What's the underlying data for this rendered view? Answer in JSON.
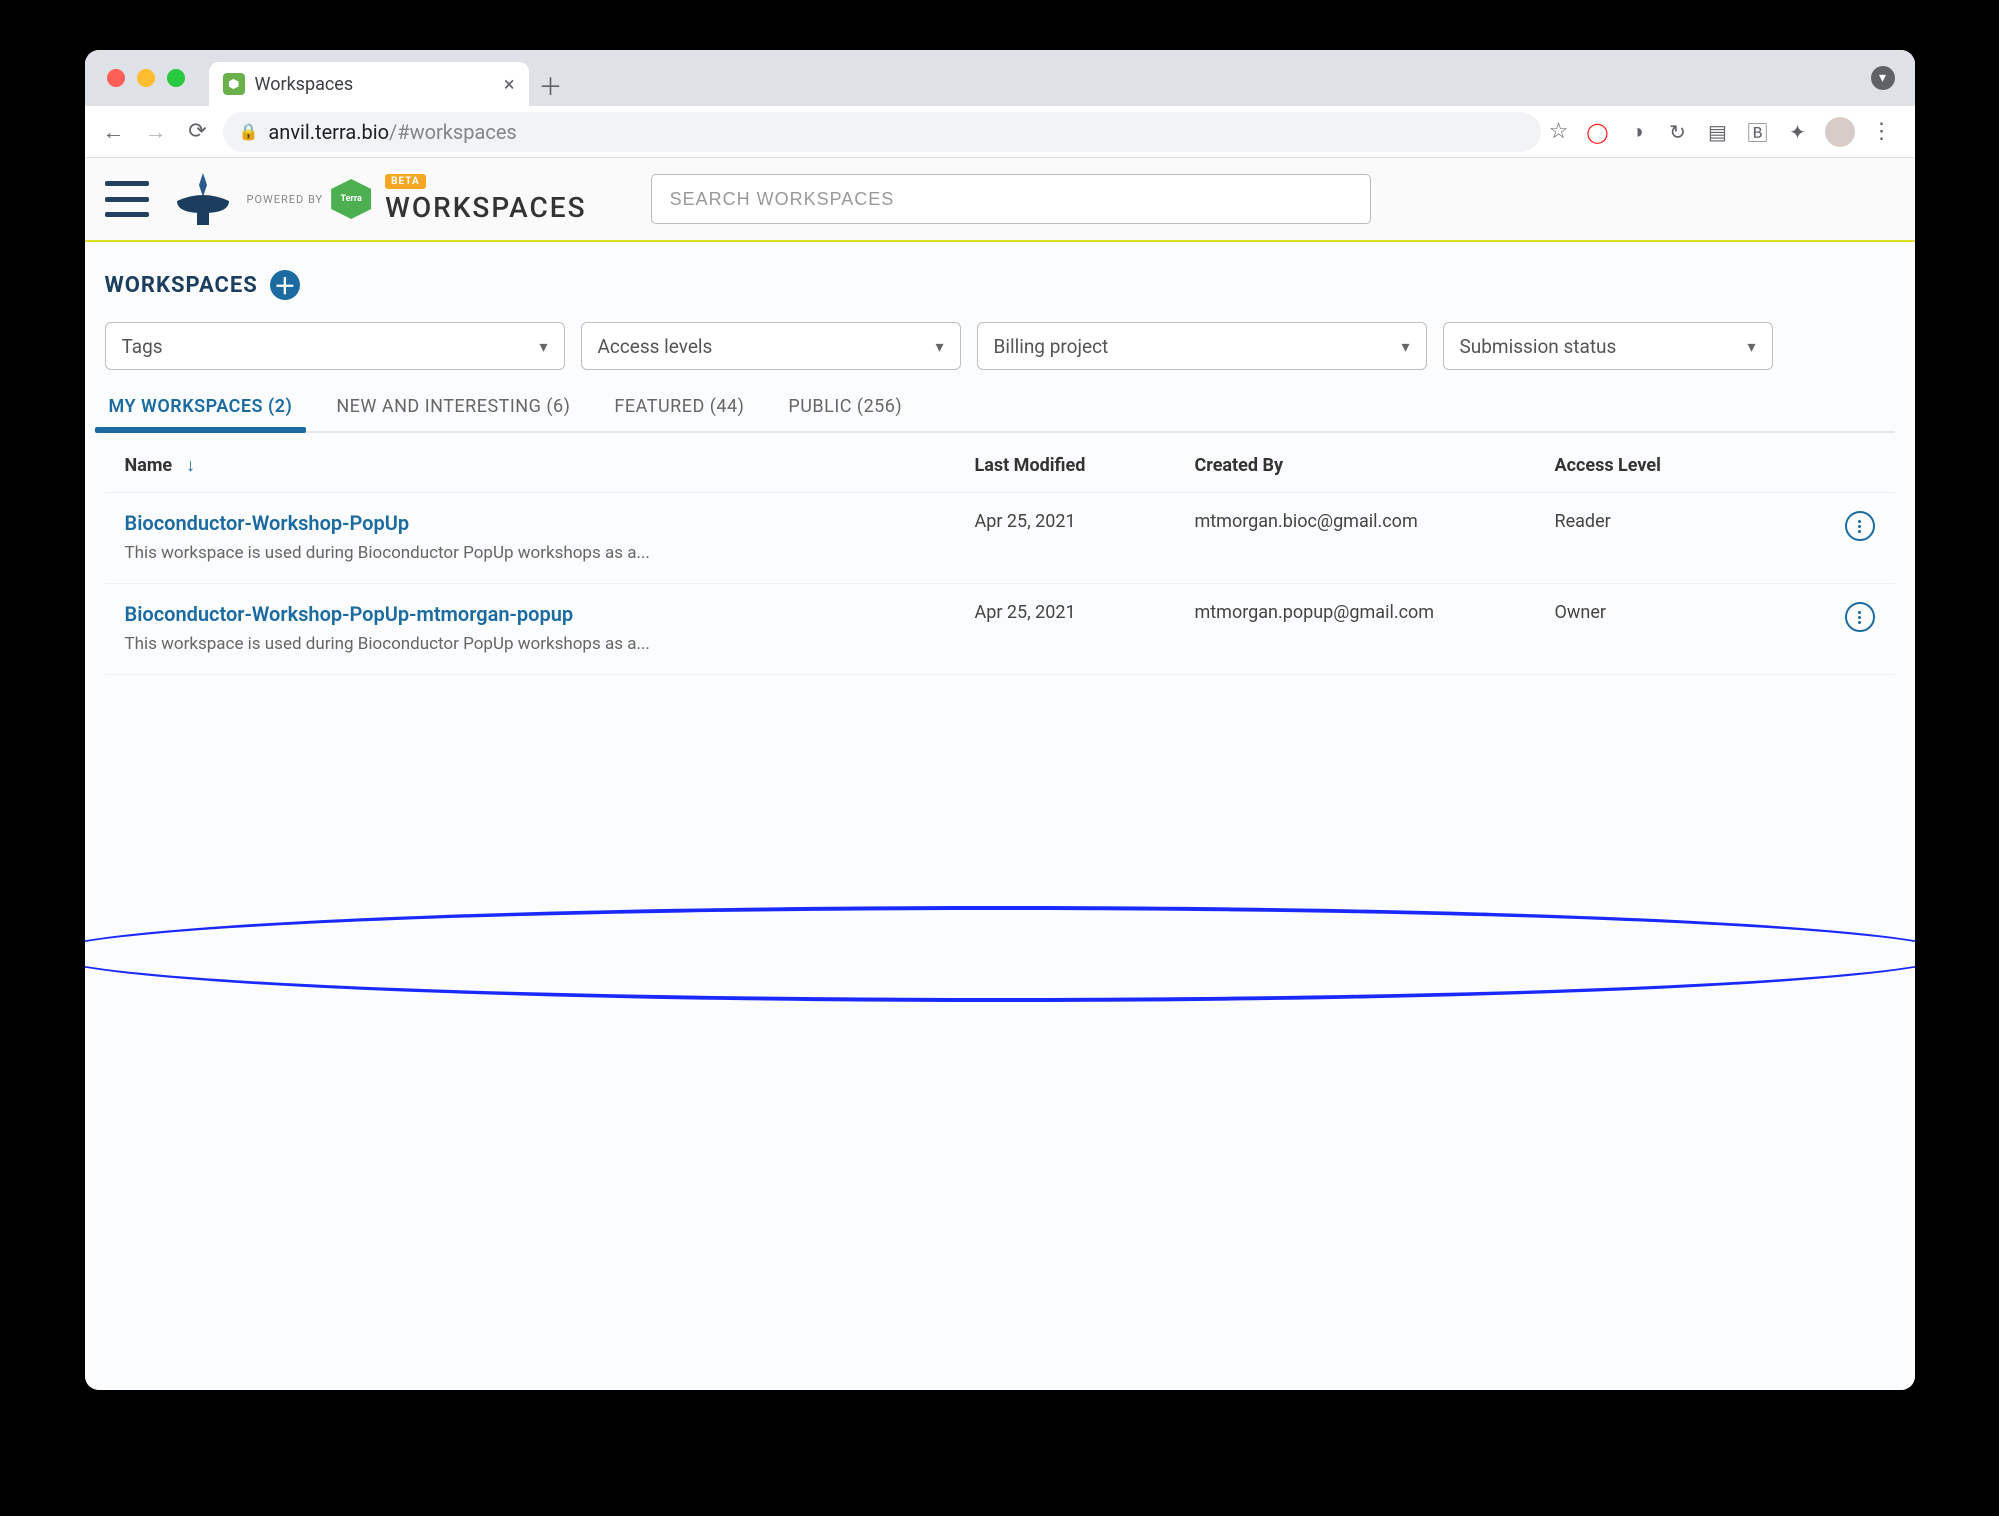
{
  "browser": {
    "tab_title": "Workspaces",
    "url_host": "anvil.terra.bio",
    "url_path": "/#workspaces"
  },
  "header": {
    "powered_by": "POWERED BY",
    "terra_label": "Terra",
    "beta": "BETA",
    "title": "WORKSPACES",
    "search_placeholder": "SEARCH WORKSPACES"
  },
  "page": {
    "title": "WORKSPACES",
    "filters": {
      "tags": "Tags",
      "access": "Access levels",
      "billing": "Billing project",
      "submission": "Submission status"
    },
    "tabs": {
      "my": "MY WORKSPACES (2)",
      "new": "NEW AND INTERESTING (6)",
      "featured": "FEATURED (44)",
      "public": "PUBLIC (256)"
    }
  },
  "table": {
    "headers": {
      "name": "Name",
      "last_modified": "Last Modified",
      "created_by": "Created By",
      "access": "Access Level"
    },
    "rows": [
      {
        "name": "Bioconductor-Workshop-PopUp",
        "desc": "This workspace is used during Bioconductor PopUp workshops as a...",
        "last_modified": "Apr 25, 2021",
        "created_by": "mtmorgan.bioc@gmail.com",
        "access": "Reader"
      },
      {
        "name": "Bioconductor-Workshop-PopUp-mtmorgan-popup",
        "desc": "This workspace is used during Bioconductor PopUp workshops as a...",
        "last_modified": "Apr 25, 2021",
        "created_by": "mtmorgan.popup@gmail.com",
        "access": "Owner"
      }
    ]
  }
}
